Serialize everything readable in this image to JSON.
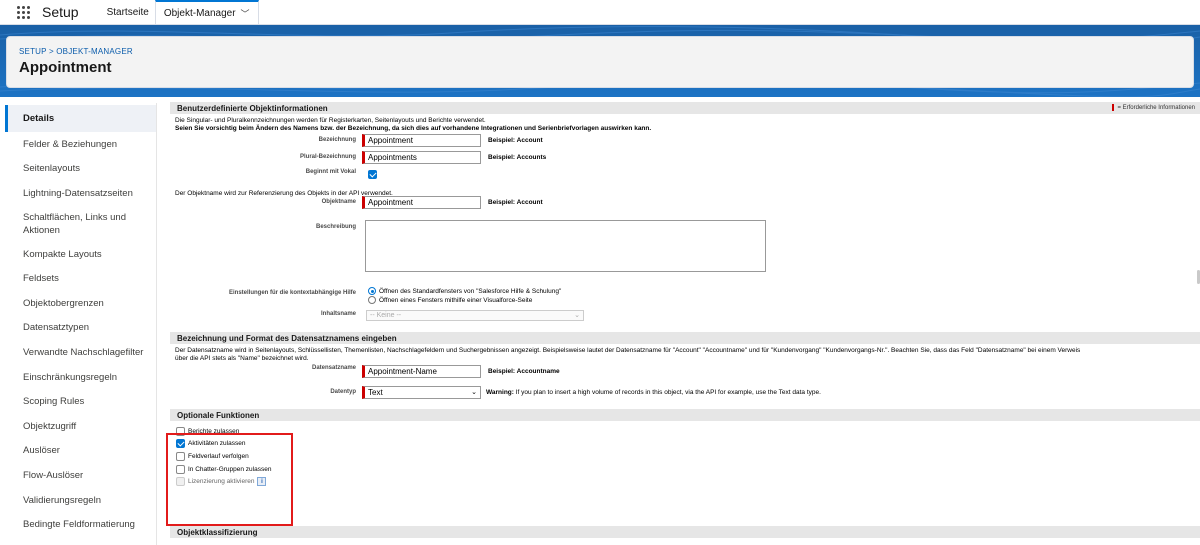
{
  "topbar": {
    "app_title": "Setup",
    "tabs": [
      {
        "label": "Startseite"
      },
      {
        "label": "Objekt-Manager"
      }
    ]
  },
  "header": {
    "breadcrumb": "SETUP > OBJEKT-MANAGER",
    "title": "Appointment"
  },
  "sidebar": {
    "items": [
      {
        "label": "Details"
      },
      {
        "label": "Felder & Beziehungen"
      },
      {
        "label": "Seitenlayouts"
      },
      {
        "label": "Lightning-Datensatzseiten"
      },
      {
        "label": "Schaltflächen, Links und Aktionen"
      },
      {
        "label": "Kompakte Layouts"
      },
      {
        "label": "Feldsets"
      },
      {
        "label": "Objektobergrenzen"
      },
      {
        "label": "Datensatztypen"
      },
      {
        "label": "Verwandte Nachschlagefilter"
      },
      {
        "label": "Einschränkungsregeln"
      },
      {
        "label": "Scoping Rules"
      },
      {
        "label": "Objektzugriff"
      },
      {
        "label": "Auslöser"
      },
      {
        "label": "Flow-Auslöser"
      },
      {
        "label": "Validierungsregeln"
      },
      {
        "label": "Bedingte Feldformatierung"
      }
    ]
  },
  "custom_info": {
    "header": "Benutzerdefinierte Objektinformationen",
    "required_legend": "= Erforderliche Informationen",
    "intro_line1": "Die Singular- und Pluralkennzeichnungen werden für Registerkarten, Seitenlayouts und Berichte verwendet.",
    "intro_line2": "Seien Sie vorsichtig beim Ändern des Namens bzw. der Bezeichnung, da sich dies auf vorhandene Integrationen und Serienbriefvorlagen auswirken kann.",
    "label_field": {
      "label": "Bezeichnung",
      "value": "Appointment",
      "example": "Beispiel:  Account"
    },
    "plural_field": {
      "label": "Plural-Bezeichnung",
      "value": "Appointments",
      "example": "Beispiel:  Accounts"
    },
    "vowel_field": {
      "label": "Beginnt mit Vokal"
    },
    "api_note": "Der Objektname wird zur Referenzierung des Objekts in der API verwendet.",
    "object_name": {
      "label": "Objektname",
      "value": "Appointment",
      "example": "Beispiel:  Account"
    },
    "description": {
      "label": "Beschreibung"
    },
    "help_settings": {
      "label": "Einstellungen für die kontextabhängige Hilfe",
      "option1": "Öffnen des Standardfensters von \"Salesforce Hilfe & Schulung\"",
      "option2": "Öffnen eines Fensters mithilfe einer Visualforce-Seite"
    },
    "content_name": {
      "label": "Inhaltsname",
      "value": "-- Keine --"
    }
  },
  "record_name": {
    "header": "Bezeichnung und Format des Datensatznamens eingeben",
    "intro_line1": "Der Datensatzname wird in Seitenlayouts, Schlüssellisten, Themenlisten, Nachschlagefeldern und Suchergebnissen angezeigt. Beispielsweise lautet der Datensatzname für \"Account\" \"Accountname\" und für \"Kundenvorgang\" \"Kundenvorgangs-Nr.\". Beachten Sie, dass das Feld \"Datensatzname\" bei einem Verweis",
    "intro_line2": "über die API stets als \"Name\" bezeichnet wird.",
    "name_field": {
      "label": "Datensatzname",
      "value": "Appointment-Name",
      "example": "Beispiel:  Accountname"
    },
    "type_field": {
      "label": "Datentyp",
      "value": "Text"
    },
    "warning_bold": "Warning:",
    "warning_text": " If you plan to insert a high volume of records in this object, via the API for example, use the Text data type."
  },
  "optional": {
    "header": "Optionale Funktionen",
    "items": [
      {
        "label": "Berichte zulassen",
        "checked": false
      },
      {
        "label": "Aktivitäten zulassen",
        "checked": true
      },
      {
        "label": "Feldverlauf verfolgen",
        "checked": false
      },
      {
        "label": "In Chatter-Gruppen zulassen",
        "checked": false
      },
      {
        "label": "Lizenzierung aktivieren",
        "checked": false
      }
    ]
  },
  "classification": {
    "header": "Objektklassifizierung"
  },
  "colors": {
    "brand": "#1d73c4",
    "accent": "#0176d3",
    "required": "#cc0000",
    "highlight": "#e21b1b"
  }
}
